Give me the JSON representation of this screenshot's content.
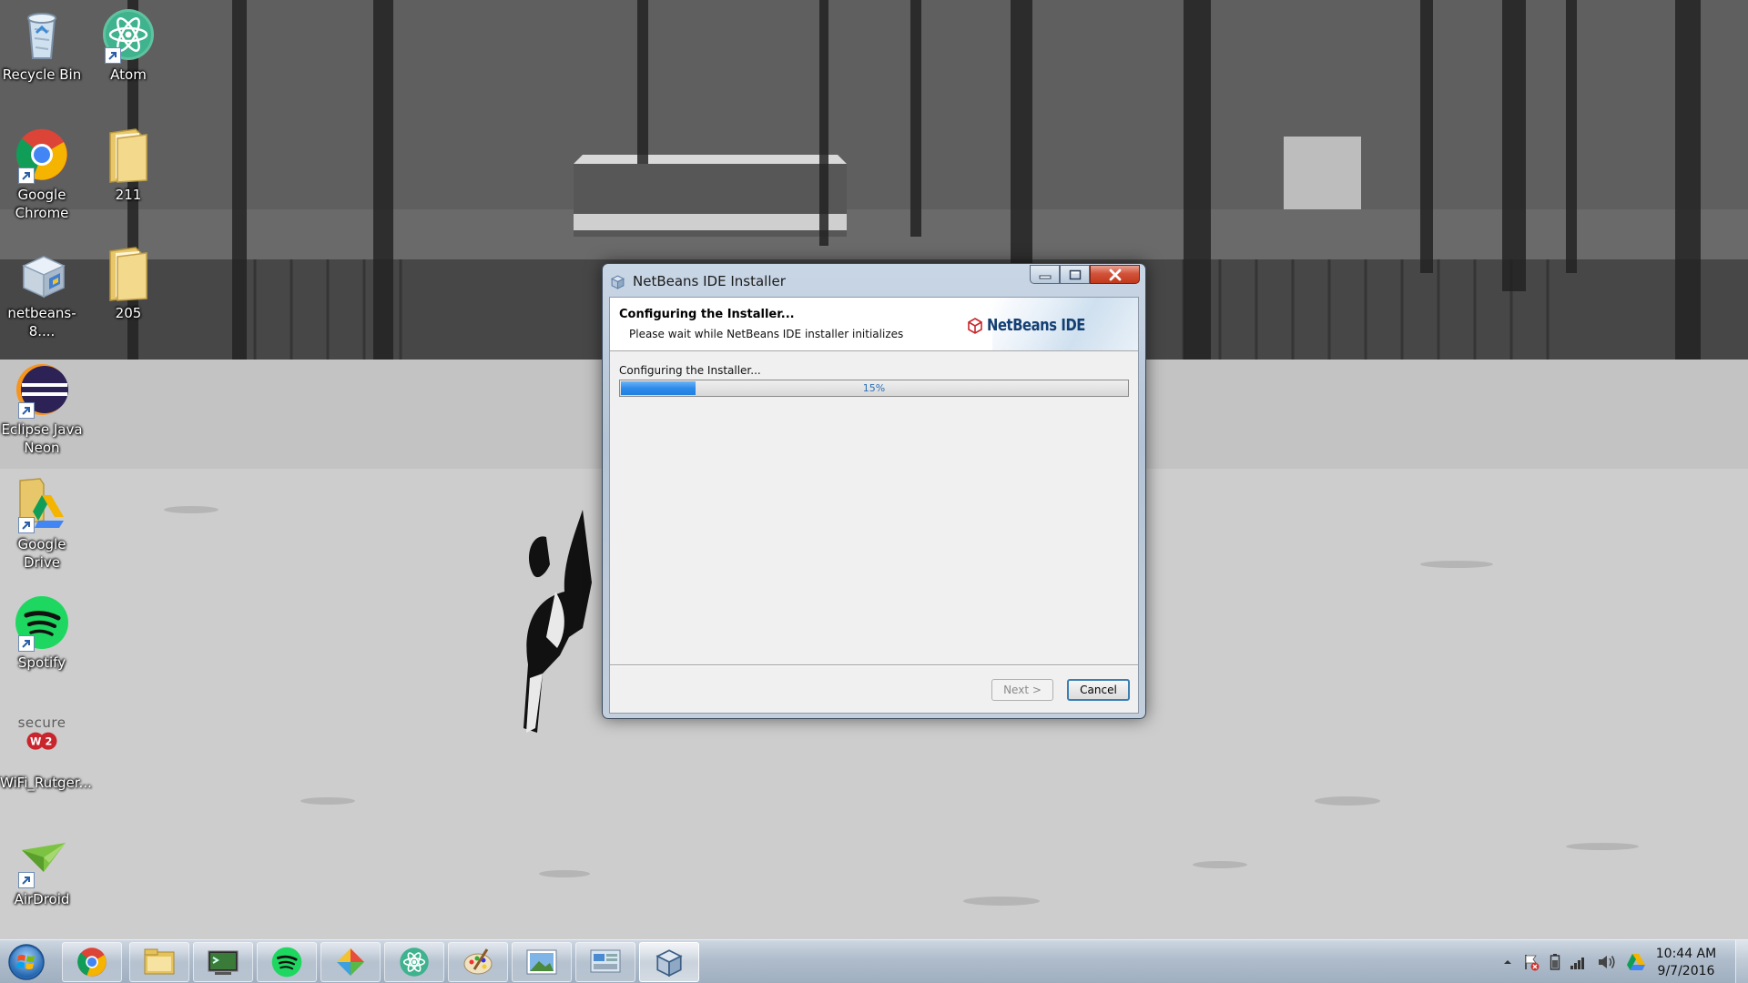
{
  "desktop": {
    "icons": [
      {
        "label": "Recycle Bin",
        "icon": "recycle-bin-icon"
      },
      {
        "label": "Atom",
        "icon": "atom-icon"
      },
      {
        "label": "Google Chrome",
        "icon": "chrome-icon"
      },
      {
        "label": "211",
        "icon": "folder-icon"
      },
      {
        "label": "netbeans-8....",
        "icon": "installer-icon"
      },
      {
        "label": "205",
        "icon": "folder-icon"
      },
      {
        "label": "Eclipse Java Neon",
        "icon": "eclipse-icon"
      },
      {
        "label": "Google Drive",
        "icon": "google-drive-icon"
      },
      {
        "label": "Spotify",
        "icon": "spotify-icon"
      },
      {
        "label": "secure",
        "icon": "securew2-logo"
      },
      {
        "label": "WiFi_Rutger...",
        "icon": "securew2-icon"
      },
      {
        "label": "AirDroid",
        "icon": "airdroid-icon"
      }
    ]
  },
  "installer": {
    "title": "NetBeans IDE Installer",
    "header_title": "Configuring the Installer...",
    "header_subtitle": "Please wait while NetBeans IDE installer initializes",
    "brand_text": "NetBeans IDE",
    "status_text": "Configuring the Installer...",
    "progress_percent": 15,
    "progress_label": "15%",
    "next_label": "Next >",
    "cancel_label": "Cancel"
  },
  "taskbar": {
    "buttons": [
      {
        "icon": "chrome-icon"
      },
      {
        "icon": "file-explorer-icon"
      },
      {
        "icon": "terminal-icon"
      },
      {
        "icon": "spotify-icon"
      },
      {
        "icon": "app-launcher-icon"
      },
      {
        "icon": "atom-icon"
      },
      {
        "icon": "paint-icon"
      },
      {
        "icon": "photo-viewer-icon"
      },
      {
        "icon": "control-panel-icon"
      },
      {
        "icon": "netbeans-installer-icon",
        "active": true
      }
    ],
    "tray_icons": [
      "show-hidden-icons-arrow",
      "action-center-flag-icon",
      "battery-icon",
      "network-signal-icon",
      "volume-icon",
      "google-drive-icon"
    ],
    "time": "10:44 AM",
    "date": "9/7/2016"
  },
  "colors": {
    "accent": "#2d8ceb",
    "close_button": "#c2391c",
    "brand": "#143f73"
  }
}
